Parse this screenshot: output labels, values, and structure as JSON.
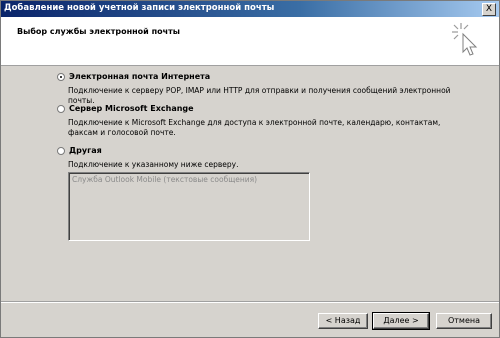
{
  "window": {
    "title": "Добавление новой учетной записи электронной почты",
    "close_glyph": "X"
  },
  "header": {
    "heading": "Выбор службы электронной почты",
    "icon": "wizard-sparkle-cursor-icon"
  },
  "options": [
    {
      "label": "Электронная почта Интернета",
      "description": "Подключение к серверу POP, IMAP или HTTP для отправки и получения сообщений электронной почты.",
      "selected": true
    },
    {
      "label": "Сервер Microsoft Exchange",
      "description": "Подключение к Microsoft Exchange для доступа к электронной почте, календарю, контактам, факсам и голосовой почте.",
      "selected": false
    },
    {
      "label": "Другая",
      "description": "Подключение к указанному ниже серверу.",
      "selected": false
    }
  ],
  "server_list": {
    "items": [
      "Служба Outlook Mobile (текстовые сообщения)"
    ],
    "enabled": false
  },
  "buttons": {
    "back": "< Назад",
    "next": "Далее >",
    "cancel": "Отмена"
  },
  "colors": {
    "dialog_bg": "#d6d3ce",
    "titlebar_start": "#0a246a",
    "titlebar_end": "#a6caf0",
    "disabled_text": "#8a8a8a"
  }
}
